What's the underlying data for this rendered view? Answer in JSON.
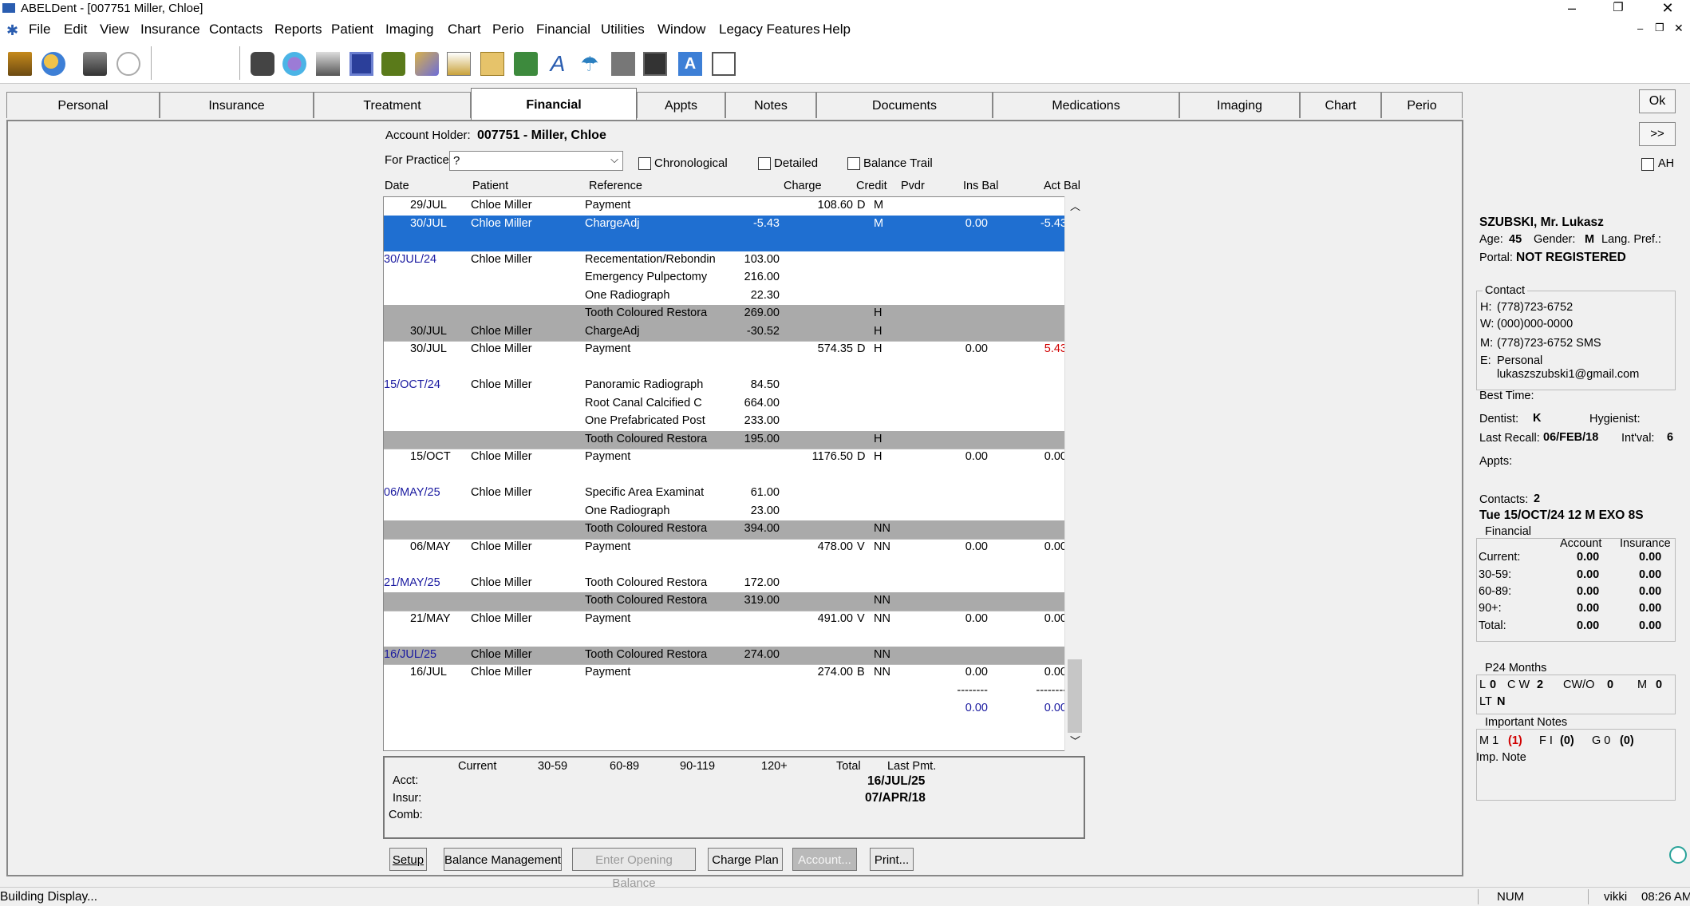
{
  "window": {
    "title": "ABELDent - [007751 Miller, Chloe]",
    "ctrl_min": "–",
    "ctrl_restore": "❐",
    "ctrl_close": "✕"
  },
  "menu": [
    "File",
    "Edit",
    "View",
    "Insurance",
    "Contacts",
    "Reports",
    "Patient",
    "Imaging",
    "Chart",
    "Perio",
    "Financial",
    "Utilities",
    "Window",
    "Legacy Features",
    "Help"
  ],
  "toolbar_icons": [
    "schedule-icon",
    "patient-search-icon",
    "notes-icon",
    "chat-icon",
    "phone-icon",
    "family-icon",
    "printer-icon",
    "ledger-icon",
    "eye-icon",
    "contacts-icon",
    "edit-icon",
    "letters-icon",
    "documents-icon",
    "font-icon",
    "umbrella-icon",
    "tooth-icon",
    "camera-icon",
    "text-icon",
    "clipboard-icon"
  ],
  "tabs": [
    "Personal",
    "Insurance",
    "Treatment",
    "Financial",
    "Appts",
    "Notes",
    "Documents",
    "Medications",
    "Imaging",
    "Chart",
    "Perio"
  ],
  "account": {
    "holder_label": "Account Holder:",
    "holder_value": "007751 - Miller, Chloe",
    "practice_label": "For Practice",
    "practice_value": "?",
    "chk_chronological": "Chronological",
    "chk_detailed": "Detailed",
    "chk_balance_trail": "Balance Trail"
  },
  "columns": {
    "date": "Date",
    "patient": "Patient",
    "reference": "Reference",
    "charge": "Charge",
    "credit": "Credit",
    "pvdr": "Pvdr",
    "ins_bal": "Ins Bal",
    "act_bal": "Act Bal"
  },
  "rows": [
    {
      "date": "29/JUL",
      "indent": true,
      "patient": "Chloe Miller",
      "ref": "Payment",
      "amt": "",
      "chg": "108.60",
      "cr": "D",
      "pv": "M",
      "ins": "",
      "act": "",
      "sep": false
    },
    {
      "date": "30/JUL",
      "indent": true,
      "patient": "Chloe Miller",
      "ref": "ChargeAdj",
      "amt": "-5.43",
      "chg": "",
      "cr": "",
      "pv": "M",
      "ins": "0.00",
      "act": "-5.43",
      "sel": true,
      "sep": false
    },
    {
      "date": "",
      "patient": "",
      "ref": "",
      "amt": "",
      "chg": "",
      "cr": "",
      "pv": "",
      "ins": "",
      "act": "",
      "sel": true,
      "sep": false
    },
    {
      "date": "30/JUL/24",
      "indent": false,
      "patient": "Chloe Miller",
      "ref": "Recementation/Rebondin",
      "amt": "103.00",
      "chg": "",
      "cr": "",
      "pv": "",
      "ins": "",
      "act": "",
      "sep": false
    },
    {
      "date": "",
      "patient": "",
      "ref": "Emergency Pulpectomy",
      "amt": "216.00",
      "chg": "",
      "cr": "",
      "pv": "",
      "ins": "",
      "act": "",
      "sep": false
    },
    {
      "date": "",
      "patient": "",
      "ref": "One Radiograph",
      "amt": "22.30",
      "chg": "",
      "cr": "",
      "pv": "",
      "ins": "",
      "act": "",
      "sep": false
    },
    {
      "date": "",
      "patient": "",
      "ref": "Tooth Coloured Restora",
      "amt": "269.00",
      "chg": "",
      "cr": "",
      "pv": "H",
      "ins": "",
      "act": "",
      "sep": true
    },
    {
      "date": "30/JUL",
      "indent": true,
      "patient": "Chloe Miller",
      "ref": "ChargeAdj",
      "amt": "-30.52",
      "chg": "",
      "cr": "",
      "pv": "H",
      "ins": "",
      "act": "",
      "sep": true
    },
    {
      "date": "30/JUL",
      "indent": true,
      "patient": "Chloe Miller",
      "ref": "Payment",
      "amt": "",
      "chg": "574.35",
      "cr": "D",
      "pv": "H",
      "ins": "0.00",
      "act": "5.43",
      "act_red": true,
      "sep": false
    },
    {
      "date": "",
      "patient": "",
      "ref": "",
      "amt": "",
      "chg": "",
      "cr": "",
      "pv": "",
      "ins": "",
      "act": "",
      "sep": false
    },
    {
      "date": "15/OCT/24",
      "indent": false,
      "patient": "Chloe Miller",
      "ref": "Panoramic Radiograph",
      "amt": "84.50",
      "chg": "",
      "cr": "",
      "pv": "",
      "ins": "",
      "act": "",
      "sep": false
    },
    {
      "date": "",
      "patient": "",
      "ref": "Root Canal Calcified C",
      "amt": "664.00",
      "chg": "",
      "cr": "",
      "pv": "",
      "ins": "",
      "act": "",
      "sep": false
    },
    {
      "date": "",
      "patient": "",
      "ref": "One Prefabricated Post",
      "amt": "233.00",
      "chg": "",
      "cr": "",
      "pv": "",
      "ins": "",
      "act": "",
      "sep": false
    },
    {
      "date": "",
      "patient": "",
      "ref": "Tooth Coloured Restora",
      "amt": "195.00",
      "chg": "",
      "cr": "",
      "pv": "H",
      "ins": "",
      "act": "",
      "sep": true
    },
    {
      "date": "15/OCT",
      "indent": true,
      "patient": "Chloe Miller",
      "ref": "Payment",
      "amt": "",
      "chg": "1176.50",
      "cr": "D",
      "pv": "H",
      "ins": "0.00",
      "act": "0.00",
      "sep": false
    },
    {
      "date": "",
      "patient": "",
      "ref": "",
      "amt": "",
      "chg": "",
      "cr": "",
      "pv": "",
      "ins": "",
      "act": "",
      "sep": false
    },
    {
      "date": "06/MAY/25",
      "indent": false,
      "patient": "Chloe Miller",
      "ref": "Specific Area Examinat",
      "amt": "61.00",
      "chg": "",
      "cr": "",
      "pv": "",
      "ins": "",
      "act": "",
      "sep": false
    },
    {
      "date": "",
      "patient": "",
      "ref": "One Radiograph",
      "amt": "23.00",
      "chg": "",
      "cr": "",
      "pv": "",
      "ins": "",
      "act": "",
      "sep": false
    },
    {
      "date": "",
      "patient": "",
      "ref": "Tooth Coloured Restora",
      "amt": "394.00",
      "chg": "",
      "cr": "",
      "pv": "NN",
      "ins": "",
      "act": "",
      "sep": true
    },
    {
      "date": "06/MAY",
      "indent": true,
      "patient": "Chloe Miller",
      "ref": "Payment",
      "amt": "",
      "chg": "478.00",
      "cr": "V",
      "pv": "NN",
      "ins": "0.00",
      "act": "0.00",
      "sep": false
    },
    {
      "date": "",
      "patient": "",
      "ref": "",
      "amt": "",
      "chg": "",
      "cr": "",
      "pv": "",
      "ins": "",
      "act": "",
      "sep": false
    },
    {
      "date": "21/MAY/25",
      "indent": false,
      "patient": "Chloe Miller",
      "ref": "Tooth Coloured Restora",
      "amt": "172.00",
      "chg": "",
      "cr": "",
      "pv": "",
      "ins": "",
      "act": "",
      "sep": false
    },
    {
      "date": "",
      "patient": "",
      "ref": "Tooth Coloured Restora",
      "amt": "319.00",
      "chg": "",
      "cr": "",
      "pv": "NN",
      "ins": "",
      "act": "",
      "sep": true
    },
    {
      "date": "21/MAY",
      "indent": true,
      "patient": "Chloe Miller",
      "ref": "Payment",
      "amt": "",
      "chg": "491.00",
      "cr": "V",
      "pv": "NN",
      "ins": "0.00",
      "act": "0.00",
      "sep": false
    },
    {
      "date": "",
      "patient": "",
      "ref": "",
      "amt": "",
      "chg": "",
      "cr": "",
      "pv": "",
      "ins": "",
      "act": "",
      "sep": false
    },
    {
      "date": "16/JUL/25",
      "indent": false,
      "patient": "Chloe Miller",
      "ref": "Tooth Coloured Restora",
      "amt": "274.00",
      "chg": "",
      "cr": "",
      "pv": "NN",
      "ins": "",
      "act": "",
      "sep": true
    },
    {
      "date": "16/JUL",
      "indent": true,
      "patient": "Chloe Miller",
      "ref": "Payment",
      "amt": "",
      "chg": "274.00",
      "cr": "B",
      "pv": "NN",
      "ins": "0.00",
      "act": "0.00",
      "sep": false
    },
    {
      "date": "",
      "patient": "",
      "ref": "",
      "amt": "",
      "chg": "",
      "cr": "",
      "pv": "",
      "ins": "--------",
      "act": "--------",
      "sep": false
    },
    {
      "date": "",
      "patient": "",
      "ref": "",
      "amt": "",
      "chg": "",
      "cr": "",
      "pv": "",
      "ins": "0.00",
      "act": "0.00",
      "blue_bal": true,
      "sep": false
    }
  ],
  "aging": {
    "h_current": "Current",
    "h_30": "30-59",
    "h_60": "60-89",
    "h_90": "90-119",
    "h_120": "120+",
    "h_total": "Total",
    "h_last": "Last Pmt.",
    "acct_label": "Acct:",
    "insur_label": "Insur:",
    "comb_label": "Comb:",
    "acct_last": "16/JUL/25",
    "insur_last": "07/APR/18"
  },
  "buttons": {
    "setup": "Setup",
    "balance": "Balance Management",
    "opening": "Enter Opening Balance",
    "charge_plan": "Charge Plan",
    "account": "Account...",
    "print": "Print..."
  },
  "right": {
    "ok": "Ok",
    "more": ">>",
    "ah": "AH",
    "name": "SZUBSKI, Mr. Lukasz",
    "age_label": "Age:",
    "age": "45",
    "gender_label": "Gender:",
    "gender": "M",
    "lang_label": "Lang. Pref.:",
    "portal_label": "Portal:",
    "portal": "NOT REGISTERED",
    "contact_title": "Contact",
    "h_label": "H:",
    "h": "(778)723-6752",
    "w_label": "W:",
    "w": "(000)000-0000",
    "m_label": "M:",
    "m": "(778)723-6752 SMS",
    "e_label": "E:",
    "e1": "Personal",
    "e2": "lukaszszubski1@gmail.com",
    "best_time": "Best Time:",
    "dentist_label": "Dentist:",
    "dentist": "K",
    "hyg_label": "Hygienist:",
    "recall_label": "Last Recall:",
    "recall": "06/FEB/18",
    "intval_label": "Int'val:",
    "intval": "6",
    "appts_label": "Appts:",
    "contacts_label": "Contacts:",
    "contacts": "2",
    "last_appt": "Tue 15/OCT/24 12 M EXO 8S",
    "fin_title": "Financial",
    "fin_account": "Account",
    "fin_insurance": "Insurance",
    "fin_rows": [
      {
        "label": "Current:",
        "acct": "0.00",
        "ins": "0.00"
      },
      {
        "label": "30-59:",
        "acct": "0.00",
        "ins": "0.00"
      },
      {
        "label": "60-89:",
        "acct": "0.00",
        "ins": "0.00"
      },
      {
        "label": "90+:",
        "acct": "0.00",
        "ins": "0.00"
      },
      {
        "label": "Total:",
        "acct": "0.00",
        "ins": "0.00"
      }
    ],
    "p24_title": "P24 Months",
    "p24_l": "L",
    "p24_l_v": "0",
    "p24_cw": "C W",
    "p24_cw_v": "2",
    "p24_cwo": "CW/O",
    "p24_cwo_v": "0",
    "p24_m": "M",
    "p24_m_v": "0",
    "p24_lt": "LT",
    "p24_lt_v": "N",
    "notes_title": "Important Notes",
    "notes_m": "M 1",
    "notes_m_v": "(1)",
    "notes_f": "F I",
    "notes_f_v": "(0)",
    "notes_g": "G 0",
    "notes_g_v": "(0)",
    "imp_note": "Imp. Note"
  },
  "status": {
    "left": "Building Display...",
    "num": "NUM",
    "user": "vikki",
    "time": "08:26 AM"
  }
}
